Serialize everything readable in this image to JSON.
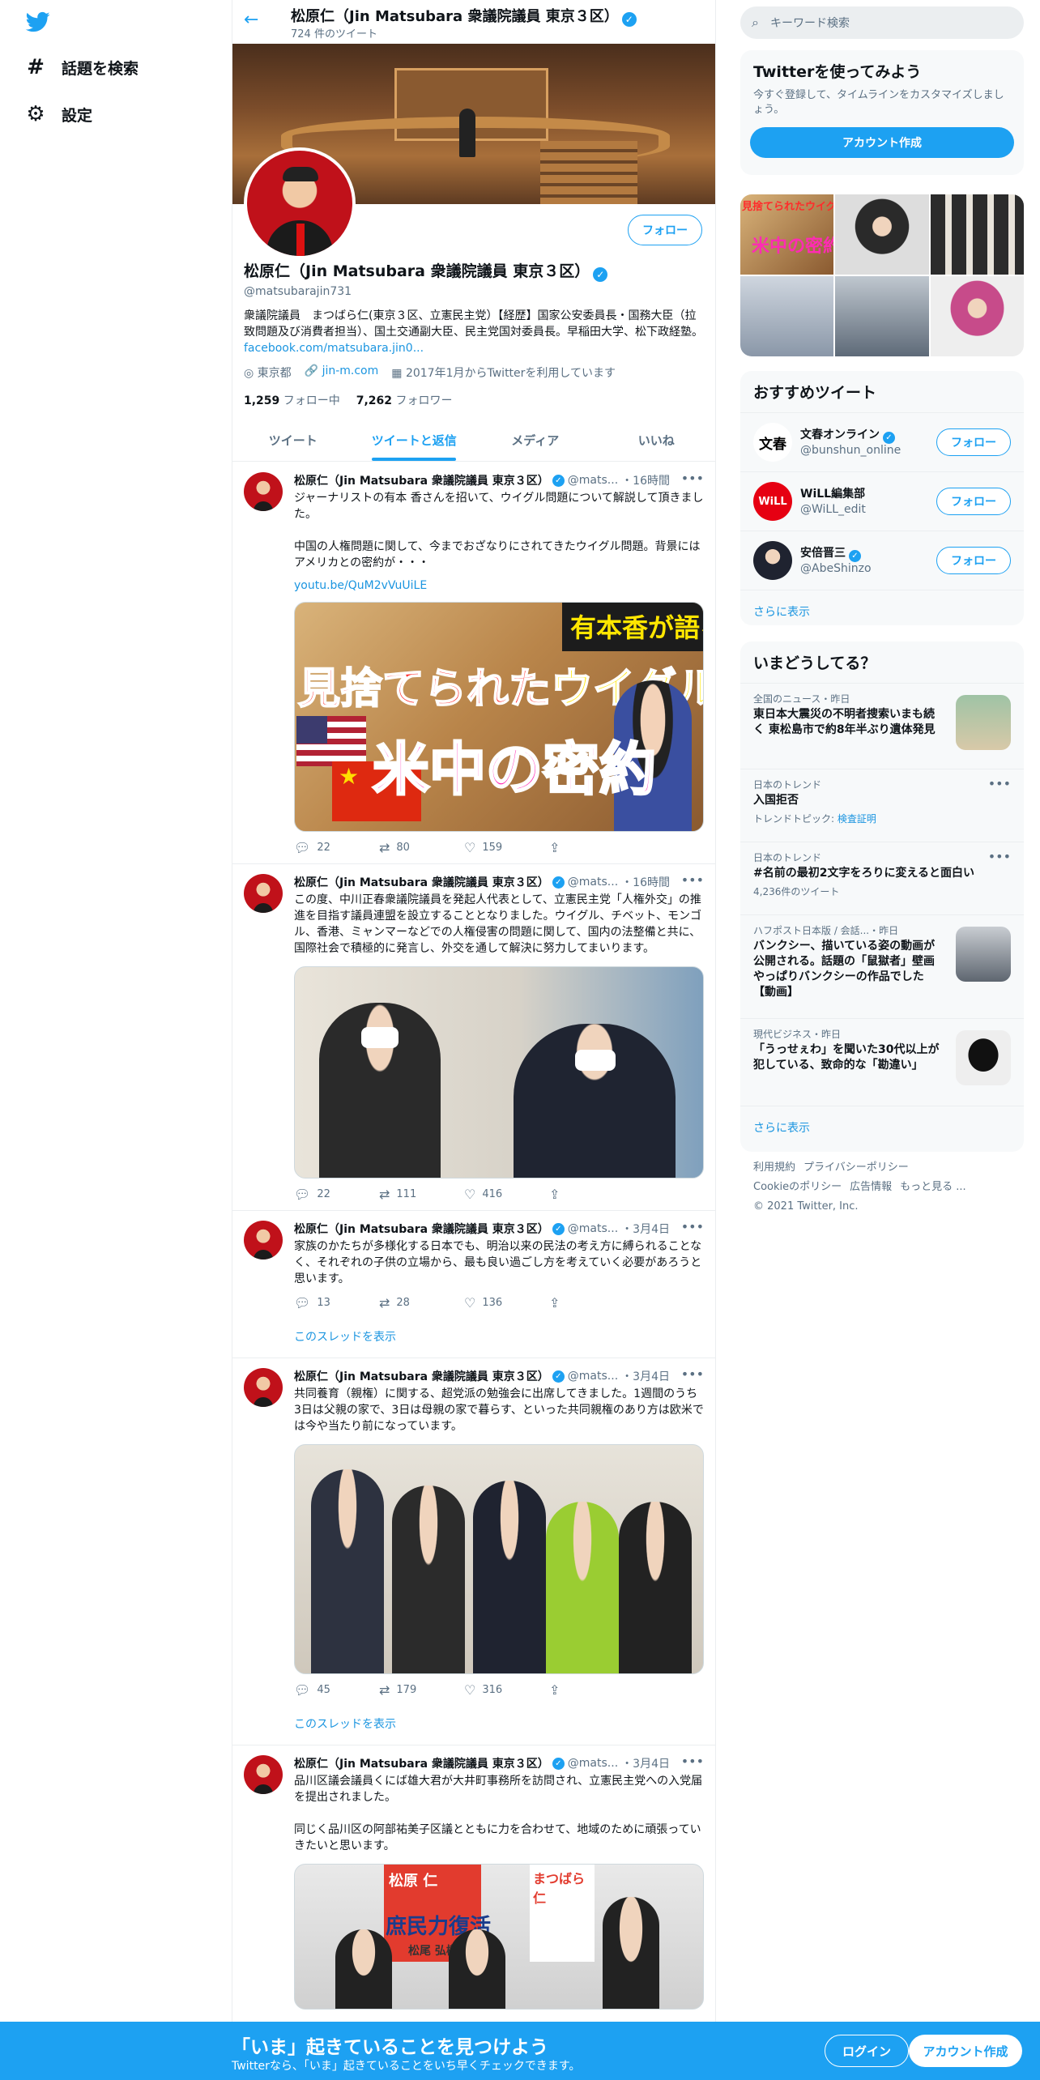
{
  "nav": {
    "explore_label": "話題を検索",
    "settings_label": "設定"
  },
  "topbar": {
    "name": "松原仁（Jin Matsubara 衆議院議員 東京３区）",
    "tweet_count": "724 件のツイート"
  },
  "profile": {
    "follow_label": "フォロー",
    "name": "松原仁（Jin Matsubara 衆議院議員 東京３区）",
    "handle": "@matsubarajin731",
    "bio": "衆議院議員　まつばら仁(東京３区、立憲民主党）【経歴】国家公安委員長・国務大臣（拉致問題及び消費者担当）、国土交通副大臣、民主党国対委員長。早稲田大学、松下政経塾。",
    "bio_link": "facebook.com/matsubara.jin0...",
    "location": "東京都",
    "website": "jin-m.com",
    "joined": "2017年1月からTwitterを利用しています",
    "following_count": "1,259",
    "following_label": "フォロー中",
    "followers_count": "7,262",
    "followers_label": "フォロワー"
  },
  "tabs": [
    "ツイート",
    "ツイートと返信",
    "メディア",
    "いいね"
  ],
  "tweets": [
    {
      "name": "松原仁（Jin Matsubara 衆議院議員 東京３区）",
      "handle": "@mats...",
      "time": "・16時間",
      "text": "ジャーナリストの有本 香さんを招いて、ウイグル問題について解説して頂きました。\n\n中国の人権問題に関して、今までおざなりにされてきたウイグル問題。背景にはアメリカとの密約が・・・",
      "link": "youtu.be/QuM2vVuUiLE",
      "media_text_top": "有本香が語る",
      "media_text_mid_a": "見捨てられた",
      "media_text_mid_b": "ウイグル人",
      "media_text_bot": "米中の密約",
      "replies": "22",
      "retweets": "80",
      "likes": "159"
    },
    {
      "name": "松原仁（Jin Matsubara 衆議院議員 東京３区）",
      "handle": "@mats...",
      "time": "・16時間",
      "text": "この度、中川正春衆議院議員を発起人代表として、立憲民主党「人権外交」の推進を目指す議員連盟を設立することとなりました。ウイグル、チベット、モンゴル、香港、ミャンマーなどでの人権侵害の問題に関して、国内の法整備と共に、国際社会で積極的に発言し、外交を通して解決に努力してまいります。",
      "replies": "22",
      "retweets": "111",
      "likes": "416"
    },
    {
      "name": "松原仁（Jin Matsubara 衆議院議員 東京３区）",
      "handle": "@mats...",
      "time": "・3月4日",
      "text": "家族のかたちが多様化する日本でも、明治以来の民法の考え方に縛られることなく、それぞれの子供の立場から、最も良い過ごし方を考えていく必要があろうと思います。",
      "replies": "13",
      "retweets": "28",
      "likes": "136",
      "thread_label": "このスレッドを表示"
    },
    {
      "name": "松原仁（Jin Matsubara 衆議院議員 東京３区）",
      "handle": "@mats...",
      "time": "・3月4日",
      "text": "共同養育（親権）に関する、超党派の勉強会に出席してきました。1週間のうち3日は父親の家で、3日は母親の家で暮らす、といった共同親権のあり方は欧米では今や当たり前になっています。",
      "replies": "45",
      "retweets": "179",
      "likes": "316",
      "thread_label": "このスレッドを表示"
    },
    {
      "name": "松原仁（Jin Matsubara 衆議院議員 東京３区）",
      "handle": "@mats...",
      "time": "・3月4日",
      "text": "品川区議会議員くにば雄大君が大井町事務所を訪問され、立憲民主党への入党届を提出されました。\n\n同じく品川区の阿部祐美子区議とともに力を合わせて、地域のために頑張っていきたいと思います。",
      "poster_a": "松原 仁",
      "poster_b": "まつばら仁",
      "poster_c": "庶民力復活",
      "poster_d": "松尾 弘樹"
    }
  ],
  "right": {
    "search_placeholder": "キーワード検索",
    "signup_title": "Twitterを使ってみよう",
    "signup_text": "今すぐ登録して、タイムラインをカスタマイズしましょう。",
    "signup_button": "アカウント作成",
    "photo_caption_a": "見捨てられたウイグル",
    "photo_caption_b": "米中の密約",
    "reco_title": "おすすめツイート",
    "reco": [
      {
        "name": "文春オンライン",
        "handle": "@bunshun_online",
        "avatar_text": "文春",
        "follow": "フォロー"
      },
      {
        "name": "WiLL編集部",
        "handle": "@WiLL_edit",
        "avatar_text": "WiLL",
        "follow": "フォロー"
      },
      {
        "name": "安倍晋三",
        "handle": "@AbeShinzo",
        "avatar_text": "",
        "follow": "フォロー"
      }
    ],
    "reco_more": "さらに表示",
    "trends_title": "いまどうしてる？",
    "trends": [
      {
        "context": "全国のニュース・昨日",
        "title": "東日本大震災の不明者捜索いまも続く 東松島市で約8年半ぶり遺体発見"
      },
      {
        "context": "日本のトレンド",
        "title": "入国拒否",
        "sub_label": "トレンドトピック:",
        "sub_link": "検査証明"
      },
      {
        "context": "日本のトレンド",
        "title": "#名前の最初2文字をろりに変えると面白い",
        "sub": "4,236件のツイート"
      },
      {
        "context": "ハフポスト日本版 / 会話...・昨日",
        "title": "バンクシー、描いている姿の動画が公開される。話題の「鼠獄者」壁画やっぱりバンクシーの作品でした【動画】"
      },
      {
        "context": "現代ビジネス・昨日",
        "title": "「うっせぇわ」を聞いた30代以上が犯している、致命的な「勘違い」"
      }
    ],
    "trends_more": "さらに表示",
    "footer": [
      "利用規約",
      "プライバシーポリシー",
      "Cookieのポリシー",
      "広告情報",
      "もっと見る ...",
      "© 2021 Twitter, Inc."
    ]
  },
  "bottombar": {
    "title": "「いま」起きていることを見つけよう",
    "subtitle": "Twitterなら、「いま」起きていることをいち早くチェックできます。",
    "login": "ログイン",
    "signup": "アカウント作成"
  },
  "colors": {
    "accent": "#1da1f2",
    "link": "#1b95e0",
    "muted": "#5b7083"
  }
}
